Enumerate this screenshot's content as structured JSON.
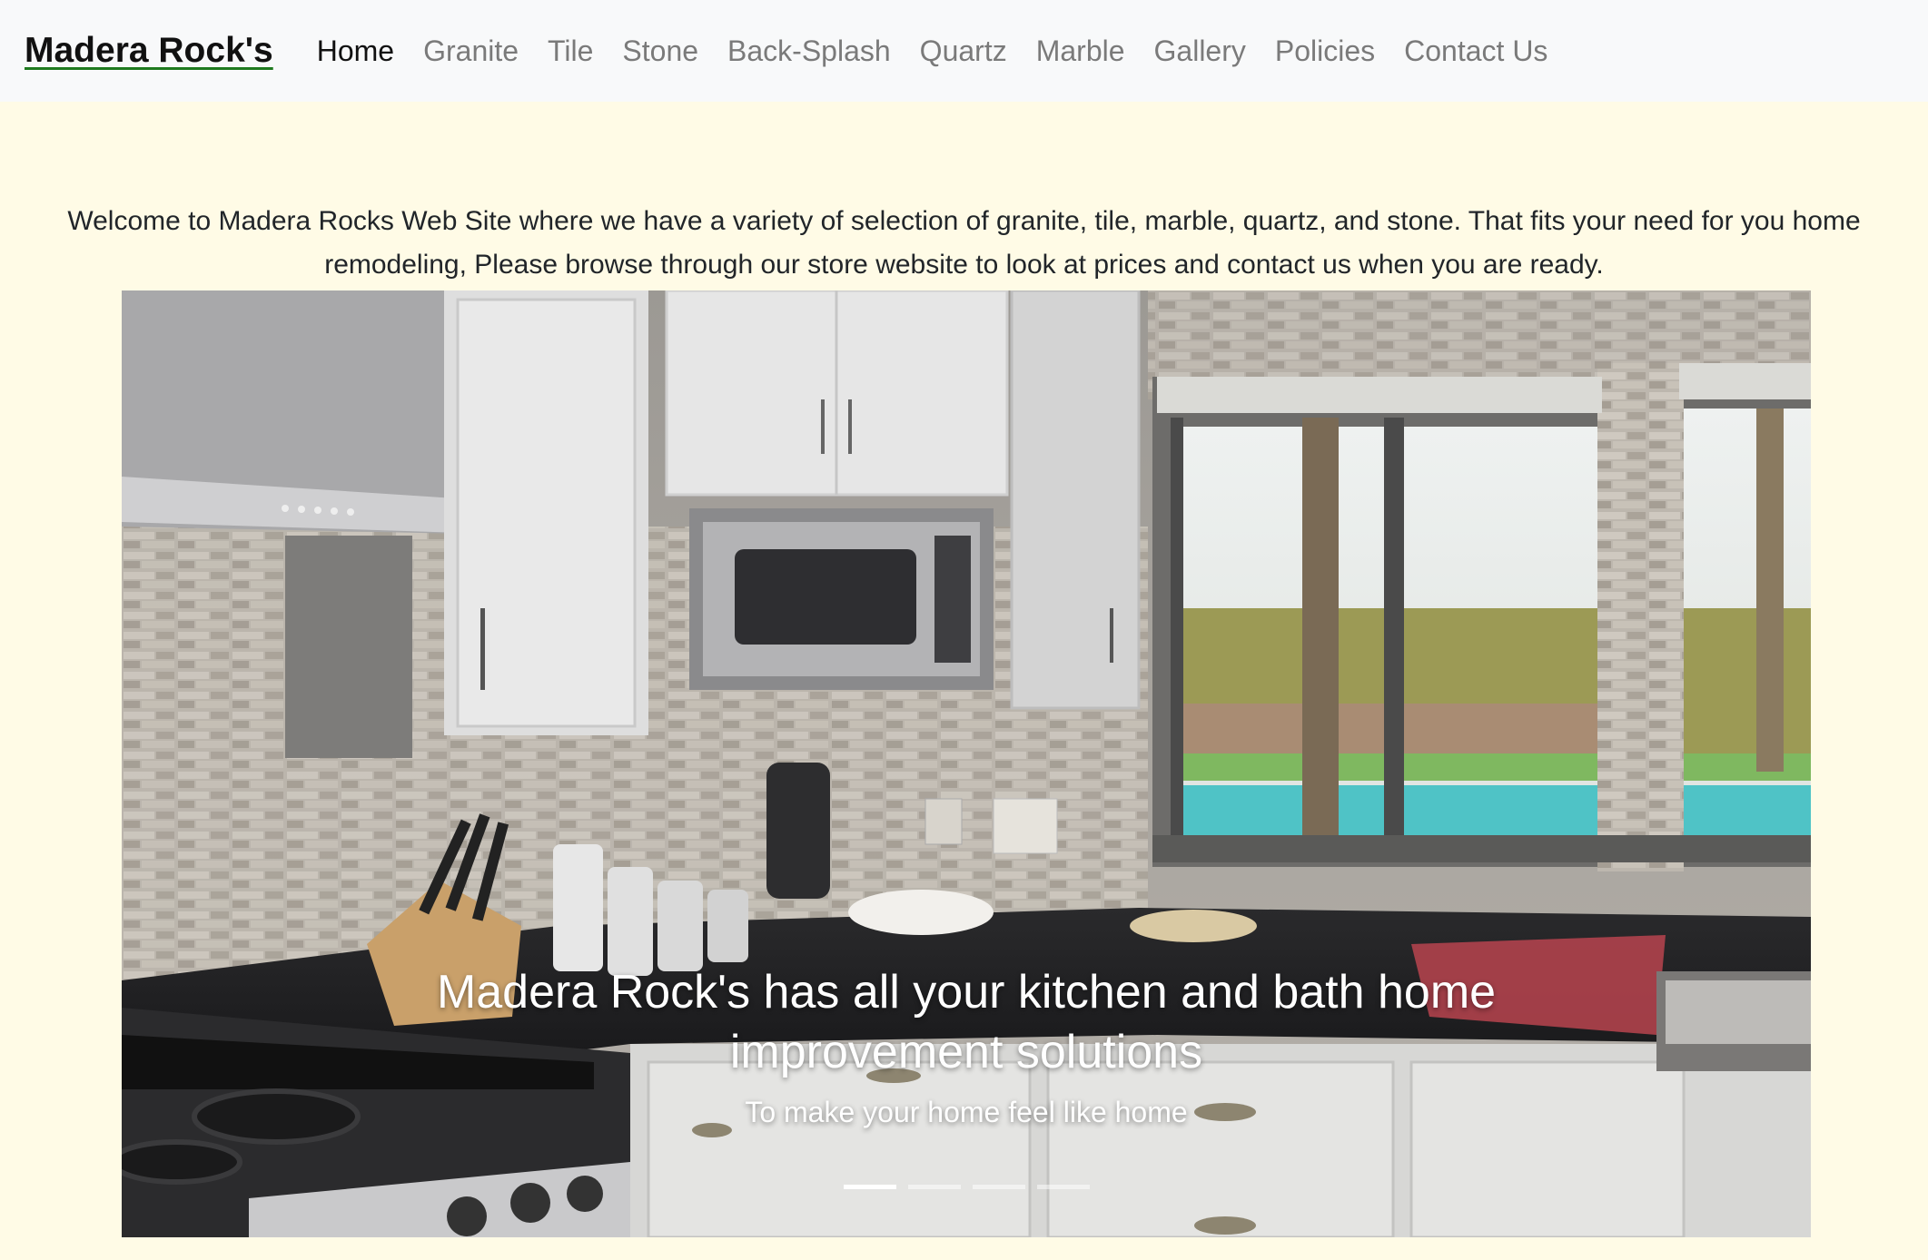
{
  "navbar": {
    "brand": "Madera Rock's",
    "items": [
      {
        "label": "Home",
        "active": true
      },
      {
        "label": "Granite",
        "active": false
      },
      {
        "label": "Tile",
        "active": false
      },
      {
        "label": "Stone",
        "active": false
      },
      {
        "label": "Back-Splash",
        "active": false
      },
      {
        "label": "Quartz",
        "active": false
      },
      {
        "label": "Marble",
        "active": false
      },
      {
        "label": "Gallery",
        "active": false
      },
      {
        "label": "Policies",
        "active": false
      },
      {
        "label": "Contact Us",
        "active": false
      }
    ]
  },
  "intro": {
    "text": "Welcome to Madera Rocks Web Site where we have a variety of selection of granite, tile, marble, quartz, and stone. That fits your need for you home remodeling, Please browse through our store website to look at prices and contact us when you are ready."
  },
  "carousel": {
    "caption_title": "Madera Rock's has all your kitchen and bath home improvement solutions",
    "caption_subtitle": "To make your home feel like home",
    "slide_count": 4,
    "active_slide": 1
  },
  "colors": {
    "page_background": "#fffbe6",
    "navbar_background": "#f8f9fa",
    "brand_underline": "#1f7a1f",
    "nav_inactive": "#7a7a7a",
    "nav_active": "#111111"
  }
}
